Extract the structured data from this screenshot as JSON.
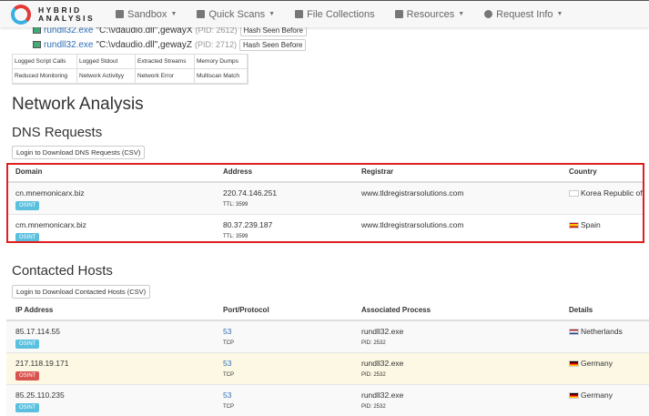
{
  "nav": {
    "logo_line1": "HYBRID",
    "logo_line2": "ANALYSIS",
    "items": [
      {
        "label": "Sandbox",
        "caret": true
      },
      {
        "label": "Quick Scans",
        "caret": true
      },
      {
        "label": "File Collections",
        "caret": false
      },
      {
        "label": "Resources",
        "caret": true
      },
      {
        "label": "Request Info",
        "caret": true
      }
    ]
  },
  "processes": [
    {
      "name": "rundll32.exe",
      "args": "\"C:\\vdaudio.dll\",gewayX",
      "pid": "(PID: 2612)",
      "hash": "Hash Seen Before"
    },
    {
      "name": "rundll32.exe",
      "args": "\"C:\\vdaudio.dll\",gewayZ",
      "pid": "(PID: 2712)",
      "hash": "Hash Seen Before"
    }
  ],
  "filters": [
    "Logged Script Calls",
    "Logged Stdout",
    "Extracted Streams",
    "Memory Dumps",
    "Reduced Monitoring",
    "Network Activityy",
    "Network Error",
    "Multiscan Match"
  ],
  "network_title": "Network Analysis",
  "dns": {
    "title": "DNS Requests",
    "download": "Login to Download DNS Requests (CSV)",
    "headers": [
      "Domain",
      "Address",
      "Registrar",
      "Country"
    ],
    "rows": [
      {
        "domain": "cn.mnemonicarx.biz",
        "badge": "OSINT",
        "address": "220.74.146.251",
        "ttl": "TTL: 3599",
        "registrar": "www.tldregistrarsolutions.com",
        "country": "Korea Republic of"
      },
      {
        "domain": "cm.mnemonicarx.biz",
        "badge": "OSINT",
        "address": "80.37.239.187",
        "ttl": "TTL: 3599",
        "registrar": "www.tldregistrarsolutions.com",
        "country": "Spain"
      }
    ]
  },
  "hosts": {
    "title": "Contacted Hosts",
    "download": "Login to Download Contacted Hosts (CSV)",
    "headers": [
      "IP Address",
      "Port/Protocol",
      "Associated Process",
      "Details"
    ],
    "rows": [
      {
        "ip": "85.17.114.55",
        "badge": "OSINT",
        "port": "53",
        "proto": "TCP",
        "process": "rundll32.exe",
        "pid": "PID: 2532",
        "country": "Netherlands"
      },
      {
        "ip": "217.118.19.171",
        "badge": "OSINT",
        "port": "53",
        "proto": "TCP",
        "process": "rundll32.exe",
        "pid": "PID: 2532",
        "country": "Germany"
      },
      {
        "ip": "85.25.110.235",
        "badge": "OSINT",
        "port": "53",
        "proto": "TCP",
        "process": "rundll32.exe",
        "pid": "PID: 2532",
        "country": "Germany"
      }
    ]
  }
}
